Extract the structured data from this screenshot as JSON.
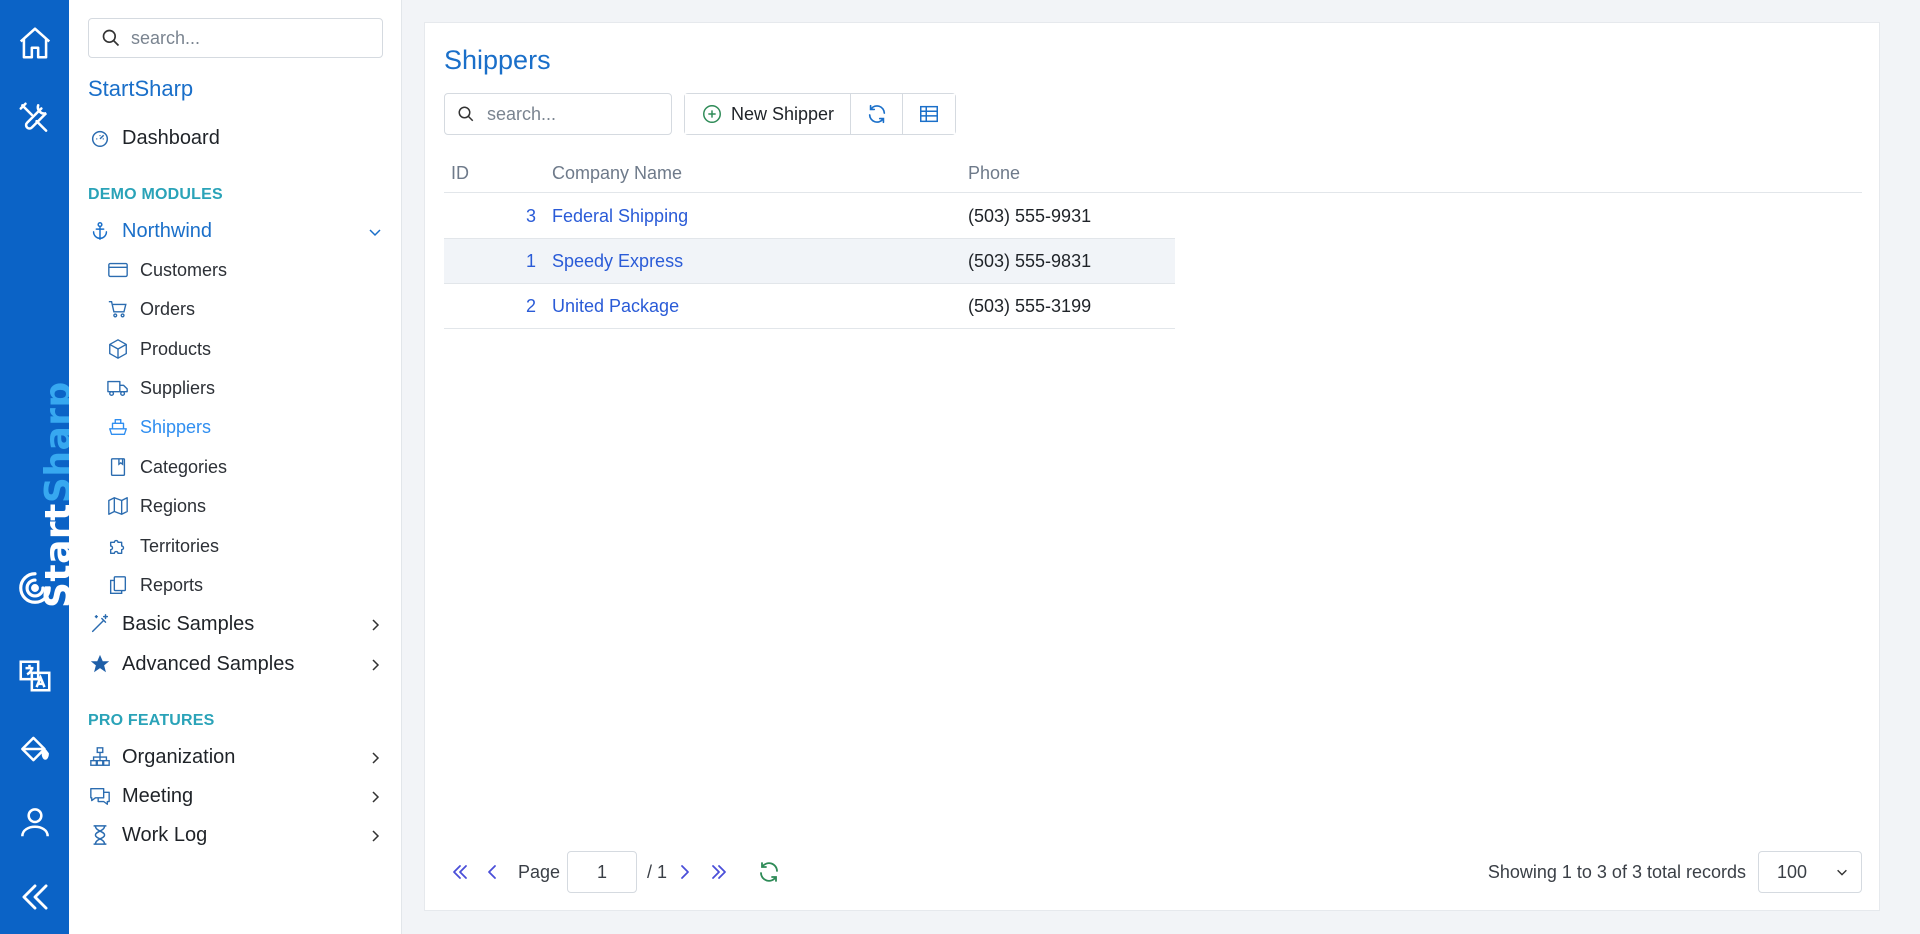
{
  "rail": {
    "brand_start": "Start",
    "brand_sharp": "Sharp"
  },
  "sidebar": {
    "search_placeholder": "search...",
    "brand": "StartSharp",
    "dashboard": "Dashboard",
    "section_demo": "DEMO MODULES",
    "northwind": "Northwind",
    "sub_items": [
      "Customers",
      "Orders",
      "Products",
      "Suppliers",
      "Shippers",
      "Categories",
      "Regions",
      "Territories",
      "Reports"
    ],
    "basic_samples": "Basic Samples",
    "advanced_samples": "Advanced Samples",
    "section_pro": "PRO FEATURES",
    "organization": "Organization",
    "meeting": "Meeting",
    "work_log": "Work Log"
  },
  "main": {
    "title": "Shippers",
    "search_placeholder": "search...",
    "new_button": "New Shipper",
    "columns": [
      "ID",
      "Company Name",
      "Phone"
    ],
    "rows": [
      {
        "id": "3",
        "company": "Federal Shipping",
        "phone": "(503) 555-9931"
      },
      {
        "id": "1",
        "company": "Speedy Express",
        "phone": "(503) 555-9831"
      },
      {
        "id": "2",
        "company": "United Package",
        "phone": "(503) 555-3199"
      }
    ]
  },
  "pager": {
    "page_label": "Page",
    "page_value": "1",
    "page_total": "/ 1",
    "status": "Showing 1 to 3 of 3 total records",
    "page_size": "100"
  },
  "colors": {
    "rail_bg": "#0b63c6",
    "accent": "#1a6fc9",
    "active": "#2f8ef0",
    "section": "#2aa3b8",
    "link": "#2a5bd7"
  }
}
